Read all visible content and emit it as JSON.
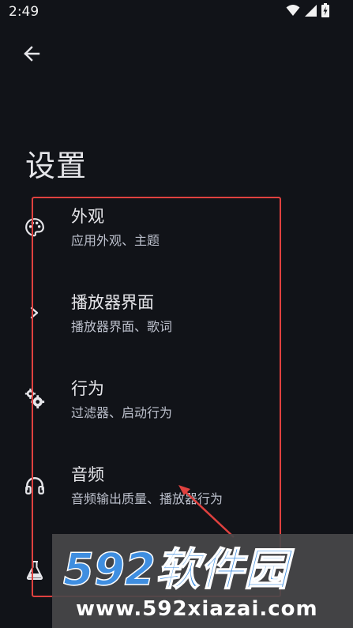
{
  "status_bar": {
    "time": "2:49",
    "icons": [
      "wifi-icon",
      "cell-signal-icon",
      "battery-charging-icon"
    ]
  },
  "header": {
    "back_icon": "arrow-left-icon"
  },
  "page": {
    "title": "设置"
  },
  "settings": {
    "items": [
      {
        "icon": "palette-icon",
        "title": "外观",
        "subtitle": "应用外观、主题"
      },
      {
        "icon": "chevron-right-icon",
        "title": "播放器界面",
        "subtitle": "播放器界面、歌词"
      },
      {
        "icon": "gears-icon",
        "title": "行为",
        "subtitle": "过滤器、启动行为"
      },
      {
        "icon": "headphones-icon",
        "title": "音频",
        "subtitle": "音频输出质量、播放器行为"
      },
      {
        "icon": "flask-icon",
        "title": "",
        "subtitle": ""
      }
    ]
  },
  "watermark": {
    "logo_text": "592软件园",
    "url": "www.592xiazai.com"
  },
  "colors": {
    "background": "#111318",
    "text_primary": "#e6e6ea",
    "text_secondary": "#bcc0cc",
    "annotation": "#e0413f",
    "watermark_blue": "#3f8ee0"
  }
}
